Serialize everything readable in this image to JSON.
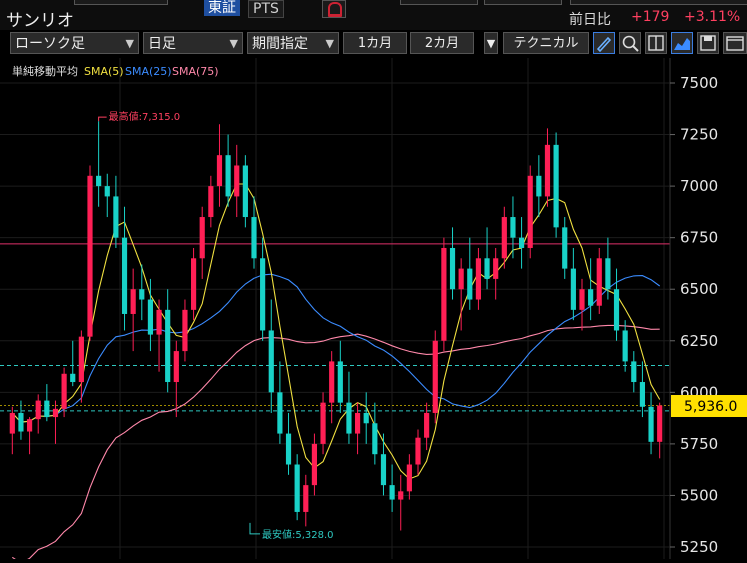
{
  "header": {
    "stock_name": "サンリオ",
    "market_tabs": [
      "東証",
      "PTS"
    ],
    "change_label": "前日比",
    "change_value": "+179",
    "change_percent": "+3.11%"
  },
  "toolbar": {
    "chart_type": "ローソク足",
    "period_type": "日足",
    "range_mode": "期間指定",
    "range_1m": "1カ月",
    "range_2m": "2カ月",
    "technical": "テクニカル",
    "icons": [
      "pen-icon",
      "zoom-icon",
      "split-icon",
      "area-chart-icon",
      "save-icon",
      "window-icon"
    ]
  },
  "chart_data": {
    "type": "candlestick",
    "legend": {
      "title": "単純移動平均",
      "sma5": "SMA(5)",
      "sma25": "SMA(25)",
      "sma75": "SMA(75)"
    },
    "colors": {
      "up": "#ff1f55",
      "down": "#19d2c8",
      "sma5": "#f0e040",
      "sma25": "#3b8cff",
      "sma75": "#ff88aa",
      "hline": "#e0306a"
    },
    "ylim": [
      5250,
      7600
    ],
    "yticks": [
      5250,
      5500,
      5750,
      6000,
      6250,
      6500,
      6750,
      7000,
      7250,
      7500
    ],
    "ytick_labels": [
      "5250",
      "5500",
      "5750",
      "6000",
      "6250",
      "6500",
      "6750",
      "7000",
      "7250",
      "7500"
    ],
    "current_price": "5,936.0",
    "current_value": 5936,
    "high_label": "最高値:7,315.0",
    "high_value": 7315,
    "low_label": "最安値:5,328.0",
    "low_value": 5328,
    "resistance_level": 6720,
    "dashed_levels": [
      6130,
      5910
    ],
    "candles": [
      [
        5800,
        5930,
        5700,
        5900
      ],
      [
        5900,
        5960,
        5770,
        5810
      ],
      [
        5810,
        5880,
        5700,
        5870
      ],
      [
        5870,
        5990,
        5800,
        5960
      ],
      [
        5960,
        6040,
        5860,
        5880
      ],
      [
        5880,
        5960,
        5750,
        5920
      ],
      [
        5920,
        6120,
        5880,
        6090
      ],
      [
        6090,
        6250,
        6030,
        6050
      ],
      [
        6050,
        6300,
        5950,
        6270
      ],
      [
        6270,
        7100,
        6250,
        7050
      ],
      [
        7050,
        7315,
        6900,
        7000
      ],
      [
        7000,
        7060,
        6850,
        6950
      ],
      [
        6950,
        7050,
        6700,
        6750
      ],
      [
        6750,
        6900,
        6300,
        6380
      ],
      [
        6380,
        6600,
        6200,
        6500
      ],
      [
        6500,
        6620,
        6350,
        6450
      ],
      [
        6450,
        6550,
        6200,
        6280
      ],
      [
        6280,
        6450,
        6100,
        6400
      ],
      [
        6400,
        6500,
        6000,
        6050
      ],
      [
        6050,
        6250,
        5880,
        6200
      ],
      [
        6200,
        6450,
        6150,
        6400
      ],
      [
        6400,
        6700,
        6350,
        6650
      ],
      [
        6650,
        6900,
        6550,
        6850
      ],
      [
        6850,
        7050,
        6800,
        7000
      ],
      [
        7000,
        7300,
        6900,
        7150
      ],
      [
        7150,
        7250,
        6900,
        6950
      ],
      [
        6950,
        7200,
        6850,
        7100
      ],
      [
        7100,
        7150,
        6800,
        6850
      ],
      [
        6850,
        6950,
        6600,
        6650
      ],
      [
        6650,
        6750,
        6250,
        6300
      ],
      [
        6300,
        6450,
        5900,
        6000
      ],
      [
        6000,
        6150,
        5750,
        5800
      ],
      [
        5800,
        5900,
        5600,
        5650
      ],
      [
        5650,
        5700,
        5380,
        5420
      ],
      [
        5420,
        5600,
        5350,
        5550
      ],
      [
        5550,
        5800,
        5500,
        5750
      ],
      [
        5750,
        6000,
        5700,
        5950
      ],
      [
        5950,
        6200,
        5850,
        6150
      ],
      [
        6150,
        6250,
        5900,
        5950
      ],
      [
        5950,
        6100,
        5750,
        5800
      ],
      [
        5800,
        5950,
        5700,
        5900
      ],
      [
        5900,
        6000,
        5750,
        5850
      ],
      [
        5850,
        5950,
        5650,
        5700
      ],
      [
        5700,
        5800,
        5500,
        5550
      ],
      [
        5550,
        5650,
        5420,
        5480
      ],
      [
        5480,
        5600,
        5330,
        5520
      ],
      [
        5520,
        5700,
        5480,
        5650
      ],
      [
        5650,
        5820,
        5600,
        5780
      ],
      [
        5780,
        5950,
        5720,
        5900
      ],
      [
        5900,
        6300,
        5850,
        6250
      ],
      [
        6250,
        6750,
        6200,
        6700
      ],
      [
        6700,
        6800,
        6450,
        6500
      ],
      [
        6500,
        6650,
        6300,
        6600
      ],
      [
        6600,
        6750,
        6400,
        6450
      ],
      [
        6450,
        6700,
        6400,
        6650
      ],
      [
        6650,
        6800,
        6500,
        6550
      ],
      [
        6550,
        6700,
        6450,
        6650
      ],
      [
        6650,
        6900,
        6600,
        6850
      ],
      [
        6850,
        6950,
        6650,
        6750
      ],
      [
        6750,
        6850,
        6600,
        6700
      ],
      [
        6700,
        7100,
        6650,
        7050
      ],
      [
        7050,
        7150,
        6850,
        6950
      ],
      [
        6950,
        7280,
        6900,
        7200
      ],
      [
        7200,
        7260,
        6750,
        6800
      ],
      [
        6800,
        6850,
        6550,
        6600
      ],
      [
        6600,
        6700,
        6350,
        6400
      ],
      [
        6400,
        6550,
        6300,
        6500
      ],
      [
        6500,
        6650,
        6350,
        6420
      ],
      [
        6420,
        6700,
        6380,
        6650
      ],
      [
        6650,
        6750,
        6450,
        6500
      ],
      [
        6500,
        6600,
        6250,
        6300
      ],
      [
        6300,
        6350,
        6100,
        6150
      ],
      [
        6150,
        6200,
        6000,
        6050
      ],
      [
        6050,
        6150,
        5880,
        5930
      ],
      [
        5930,
        6000,
        5700,
        5760
      ],
      [
        5760,
        5950,
        5680,
        5936
      ]
    ]
  }
}
